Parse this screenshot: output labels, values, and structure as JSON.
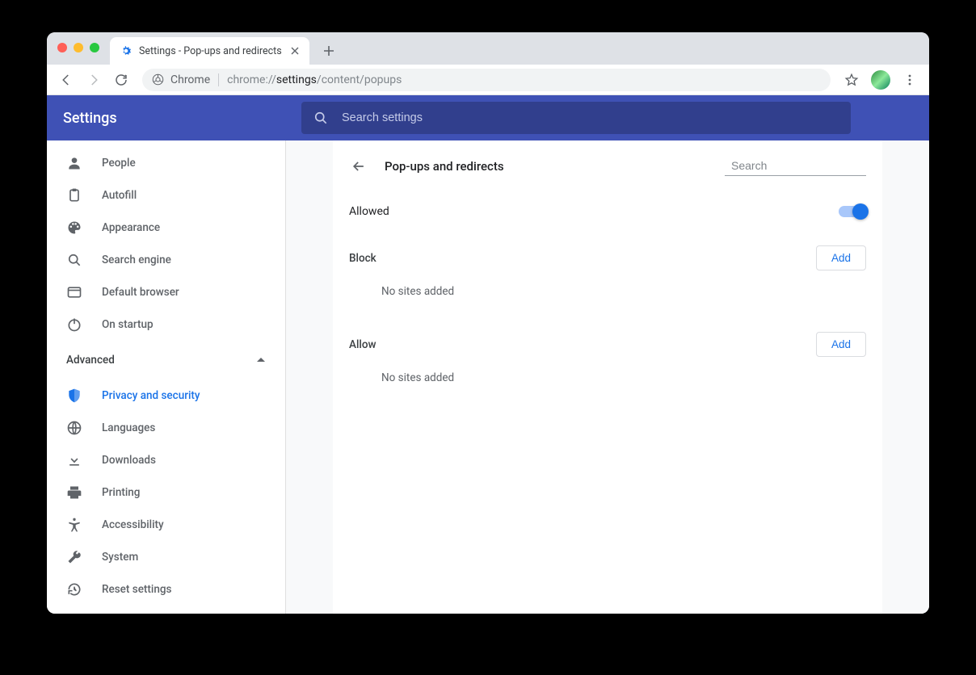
{
  "tab": {
    "title": "Settings - Pop-ups and redirects"
  },
  "omnibox": {
    "chip": "Chrome",
    "url_pre": "chrome://",
    "url_bold": "settings",
    "url_post": "/content/popups"
  },
  "header": {
    "title": "Settings",
    "search_placeholder": "Search settings"
  },
  "sidebar": {
    "items_top": [
      {
        "id": "people",
        "label": "People"
      },
      {
        "id": "autofill",
        "label": "Autofill"
      },
      {
        "id": "appearance",
        "label": "Appearance"
      },
      {
        "id": "search-engine",
        "label": "Search engine"
      },
      {
        "id": "default-browser",
        "label": "Default browser"
      },
      {
        "id": "on-startup",
        "label": "On startup"
      }
    ],
    "advanced_label": "Advanced",
    "items_adv": [
      {
        "id": "privacy",
        "label": "Privacy and security",
        "selected": true
      },
      {
        "id": "languages",
        "label": "Languages"
      },
      {
        "id": "downloads",
        "label": "Downloads"
      },
      {
        "id": "printing",
        "label": "Printing"
      },
      {
        "id": "accessibility",
        "label": "Accessibility"
      },
      {
        "id": "system",
        "label": "System"
      },
      {
        "id": "reset",
        "label": "Reset settings"
      }
    ]
  },
  "panel": {
    "title": "Pop-ups and redirects",
    "search_placeholder": "Search",
    "allowed_label": "Allowed",
    "allowed_on": true,
    "block": {
      "heading": "Block",
      "empty": "No sites added",
      "add": "Add"
    },
    "allow": {
      "heading": "Allow",
      "empty": "No sites added",
      "add": "Add"
    }
  }
}
